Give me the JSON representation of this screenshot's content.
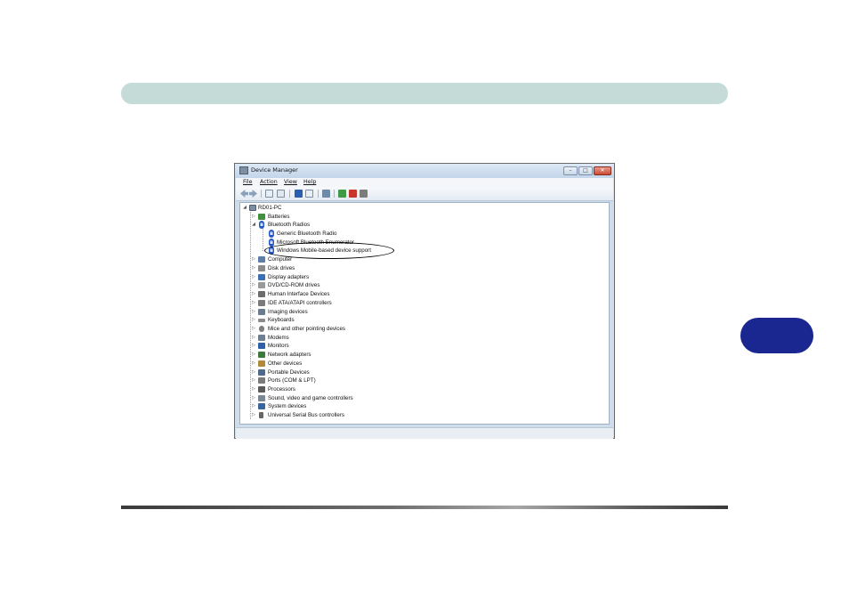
{
  "window": {
    "title": "Device Manager",
    "controls": {
      "minimize": "–",
      "maximize": "□",
      "close": "✕"
    }
  },
  "menu": [
    {
      "label": "File"
    },
    {
      "label": "Action"
    },
    {
      "label": "View"
    },
    {
      "label": "Help"
    }
  ],
  "toolbar_icons": [
    "back-arrow-icon",
    "forward-arrow-icon",
    "show-hide-console-tree-icon",
    "properties-icon",
    "help-icon",
    "show-action-pane-icon",
    "scan-hardware-changes-icon",
    "update-driver-icon",
    "uninstall-icon",
    "disable-device-icon"
  ],
  "tree": {
    "root": "RD01-PC",
    "items": [
      {
        "label": "Batteries",
        "icon": "battery-icon",
        "color": "#3f8f3f"
      },
      {
        "label": "Bluetooth Radios",
        "icon": "bluetooth-icon",
        "color": "#2457c5",
        "expanded": true,
        "children": [
          {
            "label": "Generic Bluetooth Radio"
          },
          {
            "label": "Microsoft Bluetooth Enumerator"
          },
          {
            "label": "Windows Mobile-based device support",
            "highlighted": true
          }
        ]
      },
      {
        "label": "Computer",
        "icon": "computer-icon",
        "color": "#5c7fa8"
      },
      {
        "label": "Disk drives",
        "icon": "disk-drive-icon",
        "color": "#8b8b8b"
      },
      {
        "label": "Display adapters",
        "icon": "display-adapter-icon",
        "color": "#3c6fb3"
      },
      {
        "label": "DVD/CD-ROM drives",
        "icon": "dvd-drive-icon",
        "color": "#9a9a9a"
      },
      {
        "label": "Human Interface Devices",
        "icon": "hid-icon",
        "color": "#6d6d6d"
      },
      {
        "label": "IDE ATA/ATAPI controllers",
        "icon": "ide-controller-icon",
        "color": "#7a7a7a"
      },
      {
        "label": "Imaging devices",
        "icon": "imaging-device-icon",
        "color": "#6b7c8e"
      },
      {
        "label": "Keyboards",
        "icon": "keyboard-icon",
        "color": "#8c8c8c"
      },
      {
        "label": "Mice and other pointing devices",
        "icon": "mouse-icon",
        "color": "#7f7f7f"
      },
      {
        "label": "Modems",
        "icon": "modem-icon",
        "color": "#6e7f91"
      },
      {
        "label": "Monitors",
        "icon": "monitor-icon",
        "color": "#2f5fa8"
      },
      {
        "label": "Network adapters",
        "icon": "network-adapter-icon",
        "color": "#3b7a3b"
      },
      {
        "label": "Other devices",
        "icon": "other-devices-icon",
        "color": "#b08a3a"
      },
      {
        "label": "Portable Devices",
        "icon": "portable-device-icon",
        "color": "#4d6a8a"
      },
      {
        "label": "Ports (COM & LPT)",
        "icon": "port-icon",
        "color": "#7a7a7a"
      },
      {
        "label": "Processors",
        "icon": "processor-icon",
        "color": "#5a5a5a"
      },
      {
        "label": "Sound, video and game controllers",
        "icon": "sound-icon",
        "color": "#7b8794"
      },
      {
        "label": "System devices",
        "icon": "system-device-icon",
        "color": "#3a64a0"
      },
      {
        "label": "Universal Serial Bus controllers",
        "icon": "usb-icon",
        "color": "#666666"
      }
    ]
  },
  "colors": {
    "header_bar": "#c5dbd8",
    "side_tab": "#1a2790",
    "window_frame": "#cfdcea"
  }
}
